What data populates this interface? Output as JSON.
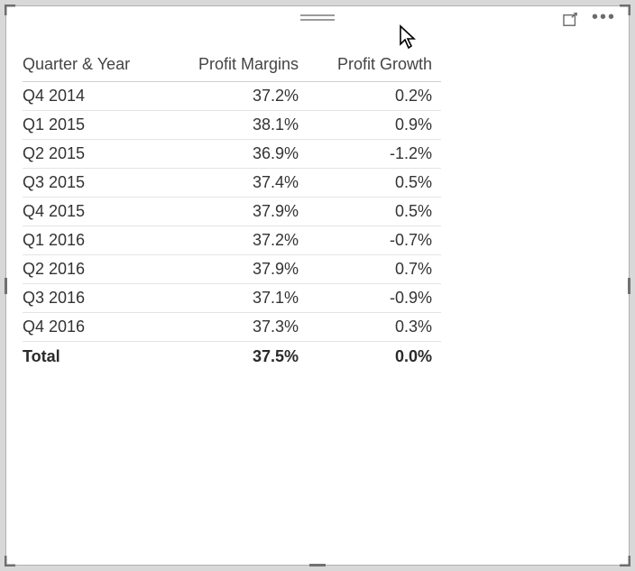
{
  "header": {
    "drag_handle": "drag",
    "focus_mode": "focus-mode",
    "more_options": "•••"
  },
  "table": {
    "headers": {
      "quarter_year": "Quarter & Year",
      "profit_margins": "Profit Margins",
      "profit_growth": "Profit Growth"
    },
    "rows": [
      {
        "quarter_year": "Q4 2014",
        "profit_margins": "37.2%",
        "profit_growth": "0.2%"
      },
      {
        "quarter_year": "Q1 2015",
        "profit_margins": "38.1%",
        "profit_growth": "0.9%"
      },
      {
        "quarter_year": "Q2 2015",
        "profit_margins": "36.9%",
        "profit_growth": "-1.2%"
      },
      {
        "quarter_year": "Q3 2015",
        "profit_margins": "37.4%",
        "profit_growth": "0.5%"
      },
      {
        "quarter_year": "Q4 2015",
        "profit_margins": "37.9%",
        "profit_growth": "0.5%"
      },
      {
        "quarter_year": "Q1 2016",
        "profit_margins": "37.2%",
        "profit_growth": "-0.7%"
      },
      {
        "quarter_year": "Q2 2016",
        "profit_margins": "37.9%",
        "profit_growth": "0.7%"
      },
      {
        "quarter_year": "Q3 2016",
        "profit_margins": "37.1%",
        "profit_growth": "-0.9%"
      },
      {
        "quarter_year": "Q4 2016",
        "profit_margins": "37.3%",
        "profit_growth": "0.3%"
      }
    ],
    "total": {
      "label": "Total",
      "profit_margins": "37.5%",
      "profit_growth": "0.0%"
    }
  },
  "chart_data": {
    "type": "table",
    "title": "",
    "columns": [
      "Quarter & Year",
      "Profit Margins",
      "Profit Growth"
    ],
    "rows": [
      [
        "Q4 2014",
        37.2,
        0.2
      ],
      [
        "Q1 2015",
        38.1,
        0.9
      ],
      [
        "Q2 2015",
        36.9,
        -1.2
      ],
      [
        "Q3 2015",
        37.4,
        0.5
      ],
      [
        "Q4 2015",
        37.9,
        0.5
      ],
      [
        "Q1 2016",
        37.2,
        -0.7
      ],
      [
        "Q2 2016",
        37.9,
        0.7
      ],
      [
        "Q3 2016",
        37.1,
        -0.9
      ],
      [
        "Q4 2016",
        37.3,
        0.3
      ]
    ],
    "totals": {
      "Profit Margins": 37.5,
      "Profit Growth": 0.0
    },
    "units": {
      "Profit Margins": "%",
      "Profit Growth": "%"
    }
  }
}
